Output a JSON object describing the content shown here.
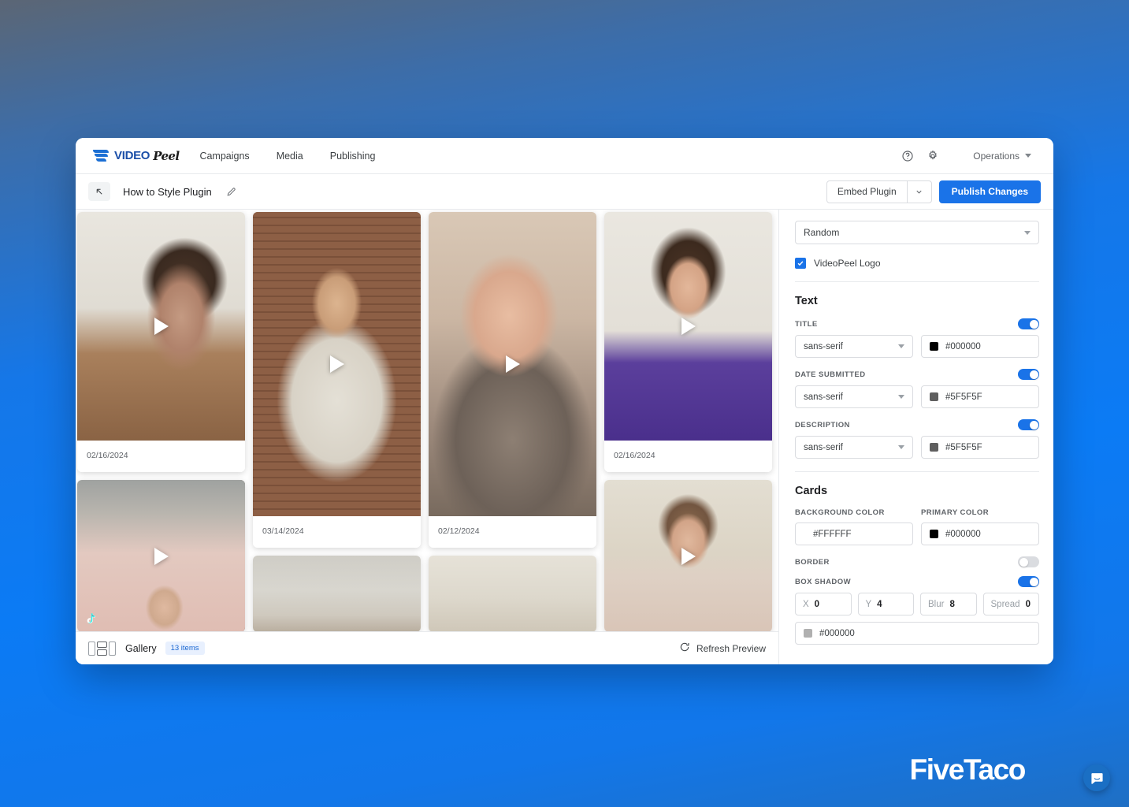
{
  "topnav": {
    "logo_primary": "VIDEO",
    "logo_secondary": "Peel",
    "links": [
      {
        "label": "Campaigns"
      },
      {
        "label": "Media"
      },
      {
        "label": "Publishing"
      }
    ],
    "help_icon": "help-circle-icon",
    "settings_icon": "gear-icon",
    "account_label": "Operations"
  },
  "subheader": {
    "back_icon": "back-arrow-icon",
    "title": "How to Style Plugin",
    "edit_icon": "pencil-icon",
    "embed_label": "Embed Plugin",
    "publish_label": "Publish Changes"
  },
  "preview": {
    "cards": [
      {
        "date": "02/16/2024",
        "photo": "ph1",
        "thumb_h": 290,
        "source": ""
      },
      {
        "date": "",
        "photo": "ph5",
        "thumb_h": 193,
        "source": "tiktok"
      },
      {
        "date": "03/14/2024",
        "photo": "ph2",
        "thumb_h": 386,
        "source": ""
      },
      {
        "date": "",
        "photo": "ph6",
        "thumb_h": 97,
        "source": ""
      },
      {
        "date": "02/12/2024",
        "photo": "ph3",
        "thumb_h": 386,
        "source": ""
      },
      {
        "date": "",
        "photo": "ph7",
        "thumb_h": 97,
        "source": ""
      },
      {
        "date": "02/16/2024",
        "photo": "ph4",
        "thumb_h": 290,
        "source": ""
      },
      {
        "date": "",
        "photo": "ph8",
        "thumb_h": 193,
        "source": ""
      }
    ],
    "footer": {
      "view_toggle_icon": "gallery-layout-icon",
      "gallery_label": "Gallery",
      "items_count": "13 items",
      "refresh_icon": "refresh-icon",
      "refresh_label": "Refresh Preview"
    }
  },
  "settings": {
    "order_select": "Random",
    "logo_checkbox_label": "VideoPeel Logo",
    "logo_checkbox_checked": true,
    "text_section": {
      "heading": "Text",
      "fields": [
        {
          "label": "TITLE",
          "enabled": true,
          "font": "sans-serif",
          "color": "#000000",
          "swatch": "#000000"
        },
        {
          "label": "DATE SUBMITTED",
          "enabled": true,
          "font": "sans-serif",
          "color": "#5F5F5F",
          "swatch": "#5F5F5F"
        },
        {
          "label": "DESCRIPTION",
          "enabled": true,
          "font": "sans-serif",
          "color": "#5F5F5F",
          "swatch": "#5F5F5F"
        }
      ]
    },
    "cards_section": {
      "heading": "Cards",
      "background_color_label": "BACKGROUND COLOR",
      "background_color_value": "#FFFFFF",
      "primary_color_label": "PRIMARY COLOR",
      "primary_color_value": "#000000",
      "primary_color_swatch": "#000000",
      "border_label": "BORDER",
      "border_enabled": false,
      "box_shadow_label": "BOX SHADOW",
      "box_shadow_enabled": true,
      "shadow": {
        "x_label": "X",
        "x_value": "0",
        "y_label": "Y",
        "y_value": "4",
        "blur_label": "Blur",
        "blur_value": "8",
        "spread_label": "Spread",
        "spread_value": "0",
        "color_value": "#000000",
        "color_swatch": "#B0B0B0"
      }
    }
  },
  "intercom": {
    "icon": "chat-bubble-icon"
  },
  "watermark": {
    "text": "FiveTaco"
  }
}
